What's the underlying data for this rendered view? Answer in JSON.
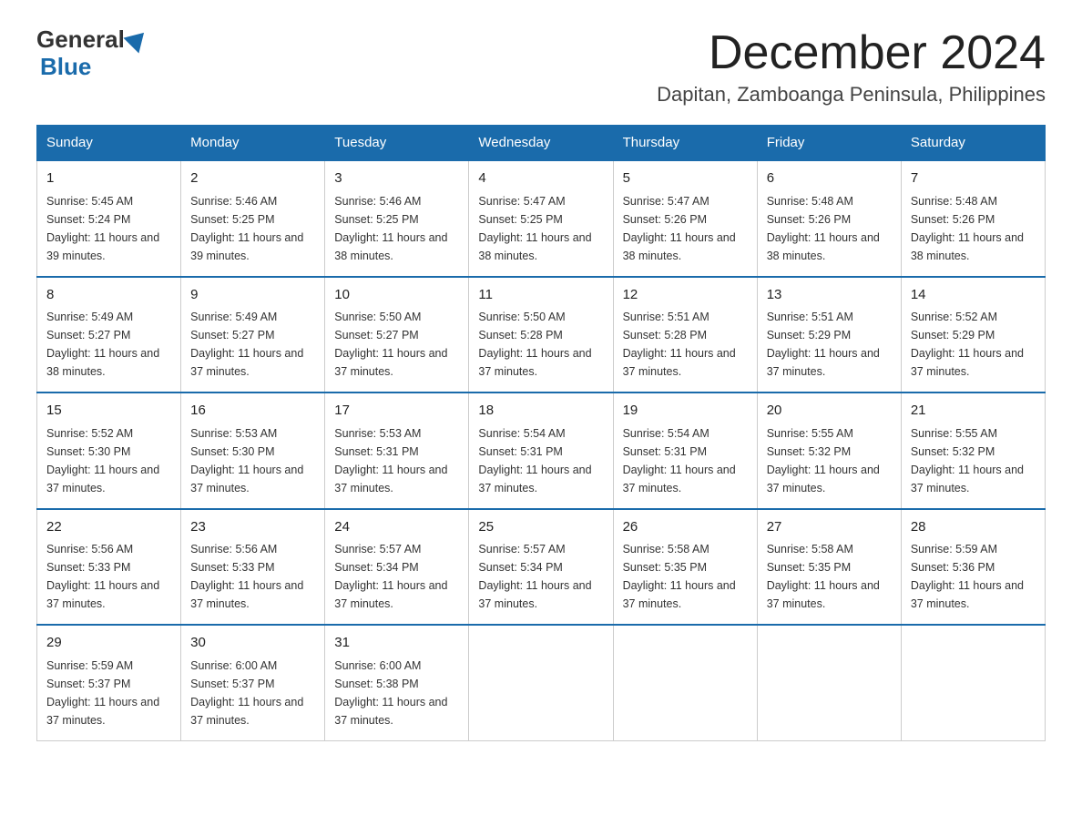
{
  "header": {
    "logo_general": "General",
    "logo_blue": "Blue",
    "month_title": "December 2024",
    "location": "Dapitan, Zamboanga Peninsula, Philippines"
  },
  "weekdays": [
    "Sunday",
    "Monday",
    "Tuesday",
    "Wednesday",
    "Thursday",
    "Friday",
    "Saturday"
  ],
  "weeks": [
    [
      {
        "day": "1",
        "sunrise": "5:45 AM",
        "sunset": "5:24 PM",
        "daylight": "11 hours and 39 minutes."
      },
      {
        "day": "2",
        "sunrise": "5:46 AM",
        "sunset": "5:25 PM",
        "daylight": "11 hours and 39 minutes."
      },
      {
        "day": "3",
        "sunrise": "5:46 AM",
        "sunset": "5:25 PM",
        "daylight": "11 hours and 38 minutes."
      },
      {
        "day": "4",
        "sunrise": "5:47 AM",
        "sunset": "5:25 PM",
        "daylight": "11 hours and 38 minutes."
      },
      {
        "day": "5",
        "sunrise": "5:47 AM",
        "sunset": "5:26 PM",
        "daylight": "11 hours and 38 minutes."
      },
      {
        "day": "6",
        "sunrise": "5:48 AM",
        "sunset": "5:26 PM",
        "daylight": "11 hours and 38 minutes."
      },
      {
        "day": "7",
        "sunrise": "5:48 AM",
        "sunset": "5:26 PM",
        "daylight": "11 hours and 38 minutes."
      }
    ],
    [
      {
        "day": "8",
        "sunrise": "5:49 AM",
        "sunset": "5:27 PM",
        "daylight": "11 hours and 38 minutes."
      },
      {
        "day": "9",
        "sunrise": "5:49 AM",
        "sunset": "5:27 PM",
        "daylight": "11 hours and 37 minutes."
      },
      {
        "day": "10",
        "sunrise": "5:50 AM",
        "sunset": "5:27 PM",
        "daylight": "11 hours and 37 minutes."
      },
      {
        "day": "11",
        "sunrise": "5:50 AM",
        "sunset": "5:28 PM",
        "daylight": "11 hours and 37 minutes."
      },
      {
        "day": "12",
        "sunrise": "5:51 AM",
        "sunset": "5:28 PM",
        "daylight": "11 hours and 37 minutes."
      },
      {
        "day": "13",
        "sunrise": "5:51 AM",
        "sunset": "5:29 PM",
        "daylight": "11 hours and 37 minutes."
      },
      {
        "day": "14",
        "sunrise": "5:52 AM",
        "sunset": "5:29 PM",
        "daylight": "11 hours and 37 minutes."
      }
    ],
    [
      {
        "day": "15",
        "sunrise": "5:52 AM",
        "sunset": "5:30 PM",
        "daylight": "11 hours and 37 minutes."
      },
      {
        "day": "16",
        "sunrise": "5:53 AM",
        "sunset": "5:30 PM",
        "daylight": "11 hours and 37 minutes."
      },
      {
        "day": "17",
        "sunrise": "5:53 AM",
        "sunset": "5:31 PM",
        "daylight": "11 hours and 37 minutes."
      },
      {
        "day": "18",
        "sunrise": "5:54 AM",
        "sunset": "5:31 PM",
        "daylight": "11 hours and 37 minutes."
      },
      {
        "day": "19",
        "sunrise": "5:54 AM",
        "sunset": "5:31 PM",
        "daylight": "11 hours and 37 minutes."
      },
      {
        "day": "20",
        "sunrise": "5:55 AM",
        "sunset": "5:32 PM",
        "daylight": "11 hours and 37 minutes."
      },
      {
        "day": "21",
        "sunrise": "5:55 AM",
        "sunset": "5:32 PM",
        "daylight": "11 hours and 37 minutes."
      }
    ],
    [
      {
        "day": "22",
        "sunrise": "5:56 AM",
        "sunset": "5:33 PM",
        "daylight": "11 hours and 37 minutes."
      },
      {
        "day": "23",
        "sunrise": "5:56 AM",
        "sunset": "5:33 PM",
        "daylight": "11 hours and 37 minutes."
      },
      {
        "day": "24",
        "sunrise": "5:57 AM",
        "sunset": "5:34 PM",
        "daylight": "11 hours and 37 minutes."
      },
      {
        "day": "25",
        "sunrise": "5:57 AM",
        "sunset": "5:34 PM",
        "daylight": "11 hours and 37 minutes."
      },
      {
        "day": "26",
        "sunrise": "5:58 AM",
        "sunset": "5:35 PM",
        "daylight": "11 hours and 37 minutes."
      },
      {
        "day": "27",
        "sunrise": "5:58 AM",
        "sunset": "5:35 PM",
        "daylight": "11 hours and 37 minutes."
      },
      {
        "day": "28",
        "sunrise": "5:59 AM",
        "sunset": "5:36 PM",
        "daylight": "11 hours and 37 minutes."
      }
    ],
    [
      {
        "day": "29",
        "sunrise": "5:59 AM",
        "sunset": "5:37 PM",
        "daylight": "11 hours and 37 minutes."
      },
      {
        "day": "30",
        "sunrise": "6:00 AM",
        "sunset": "5:37 PM",
        "daylight": "11 hours and 37 minutes."
      },
      {
        "day": "31",
        "sunrise": "6:00 AM",
        "sunset": "5:38 PM",
        "daylight": "11 hours and 37 minutes."
      },
      null,
      null,
      null,
      null
    ]
  ]
}
